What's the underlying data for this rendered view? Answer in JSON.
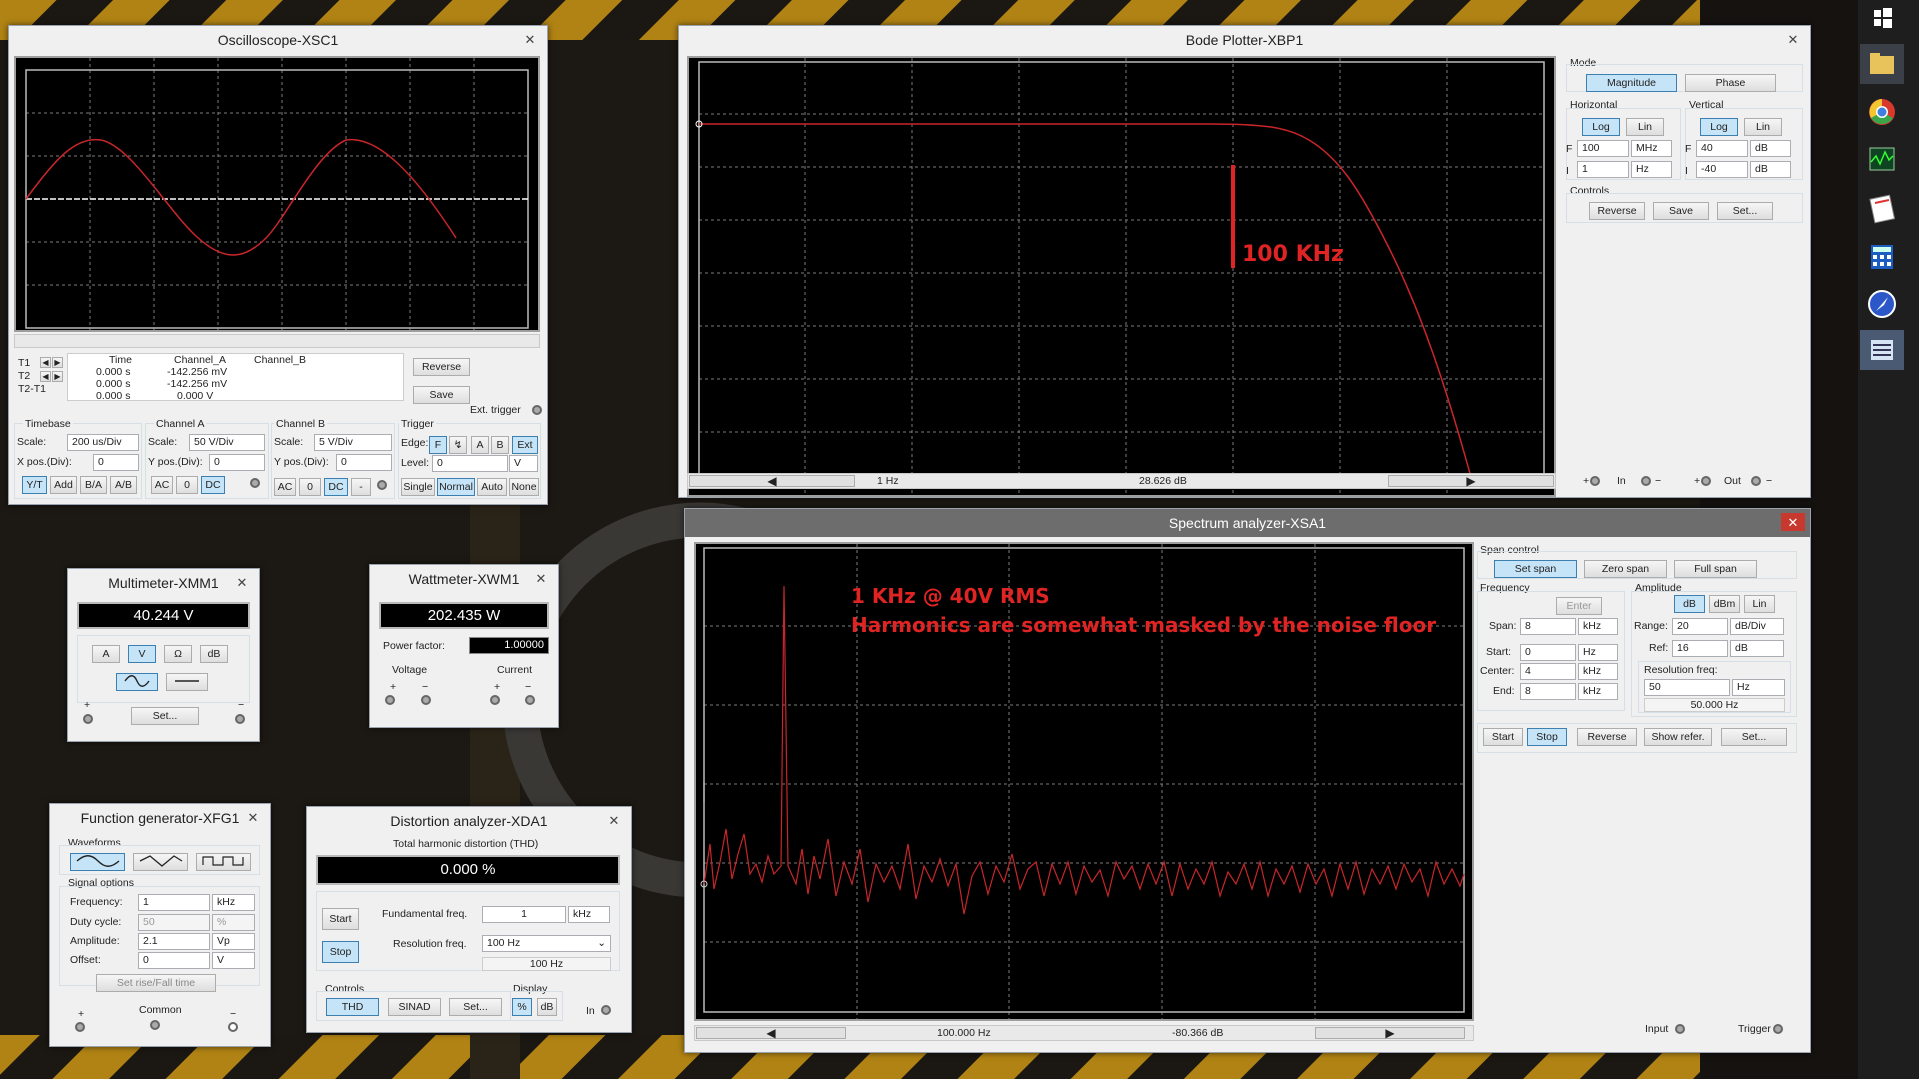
{
  "oscilloscope": {
    "title": "Oscilloscope-XSC1",
    "close": "✕",
    "readout": {
      "col_time": "Time",
      "col_a": "Channel_A",
      "col_b": "Channel_B",
      "rows": [
        {
          "label": "T1",
          "time": "0.000 s",
          "a": "-142.256 mV"
        },
        {
          "label": "T2",
          "time": "0.000 s",
          "a": "-142.256 mV"
        },
        {
          "label": "T2-T1",
          "time": "0.000 s",
          "a": "0.000 V"
        }
      ]
    },
    "reverse": "Reverse",
    "save": "Save",
    "ext_trigger": "Ext. trigger",
    "timebase": {
      "title": "Timebase",
      "scale_label": "Scale:",
      "scale": "200 us/Div",
      "xpos_label": "X pos.(Div):",
      "xpos": "0",
      "buttons": [
        "Y/T",
        "Add",
        "B/A",
        "A/B"
      ]
    },
    "channel_a": {
      "title": "Channel A",
      "scale_label": "Scale:",
      "scale": "50  V/Div",
      "ypos_label": "Y pos.(Div):",
      "ypos": "0",
      "buttons": [
        "AC",
        "0",
        "DC"
      ]
    },
    "channel_b": {
      "title": "Channel B",
      "scale_label": "Scale:",
      "scale": "5  V/Div",
      "ypos_label": "Y pos.(Div):",
      "ypos": "0",
      "buttons": [
        "AC",
        "0",
        "DC",
        "-"
      ]
    },
    "trigger": {
      "title": "Trigger",
      "edge_label": "Edge:",
      "edge_buttons": [
        "F",
        "↯",
        "A",
        "B",
        "Ext"
      ],
      "level_label": "Level:",
      "level": "0",
      "level_unit": "V",
      "mode_buttons": [
        "Single",
        "Normal",
        "Auto",
        "None"
      ]
    }
  },
  "bode": {
    "title": "Bode Plotter-XBP1",
    "close": "✕",
    "annotation": "100 KHz",
    "status": {
      "freq": "1 Hz",
      "value": "28.626 dB"
    },
    "mode": {
      "title": "Mode",
      "magnitude": "Magnitude",
      "phase": "Phase"
    },
    "horizontal": {
      "title": "Horizontal",
      "log": "Log",
      "lin": "Lin",
      "f_label": "F",
      "f_value": "100",
      "f_unit": "MHz",
      "i_label": "I",
      "i_value": "1",
      "i_unit": "Hz"
    },
    "vertical": {
      "title": "Vertical",
      "log": "Log",
      "lin": "Lin",
      "f_label": "F",
      "f_value": "40",
      "f_unit": "dB",
      "i_label": "I",
      "i_value": "-40",
      "i_unit": "dB"
    },
    "controls": {
      "title": "Controls",
      "reverse": "Reverse",
      "save": "Save",
      "set": "Set..."
    },
    "terminals": {
      "in_label": "In",
      "out_label": "Out",
      "plus": "+",
      "minus": "−"
    }
  },
  "multimeter": {
    "title": "Multimeter-XMM1",
    "close": "✕",
    "reading": "40.244 V",
    "modes": [
      "A",
      "V",
      "Ω",
      "dB"
    ],
    "set": "Set...",
    "plus": "+",
    "minus": "−"
  },
  "wattmeter": {
    "title": "Wattmeter-XWM1",
    "close": "✕",
    "reading": "202.435 W",
    "pf_label": "Power factor:",
    "pf_value": "1.00000",
    "voltage": "Voltage",
    "current": "Current",
    "plus": "+",
    "minus": "−"
  },
  "function_generator": {
    "title": "Function generator-XFG1",
    "close": "✕",
    "waveforms_title": "Waveforms",
    "signal_title": "Signal options",
    "fields": [
      {
        "label": "Frequency:",
        "value": "1",
        "unit": "kHz"
      },
      {
        "label": "Duty cycle:",
        "value": "50",
        "unit": "%"
      },
      {
        "label": "Amplitude:",
        "value": "2.1",
        "unit": "Vp"
      },
      {
        "label": "Offset:",
        "value": "0",
        "unit": "V"
      }
    ],
    "rise_fall": "Set rise/Fall time",
    "common": "Common",
    "plus": "+",
    "minus": "−"
  },
  "distortion": {
    "title": "Distortion analyzer-XDA1",
    "close": "✕",
    "thd_title": "Total harmonic distortion (THD)",
    "thd_value": "0.000 %",
    "start": "Start",
    "stop": "Stop",
    "fund_label": "Fundamental freq.",
    "fund_value": "1",
    "fund_unit": "kHz",
    "res_label": "Resolution freq.",
    "res_value": "100 Hz",
    "res_display": "100 Hz",
    "controls_title": "Controls",
    "display_title": "Display",
    "thd": "THD",
    "sinad": "SINAD",
    "set": "Set...",
    "pct": "%",
    "db": "dB",
    "in": "In"
  },
  "spectrum": {
    "title": "Spectrum analyzer-XSA1",
    "close": "✕",
    "annotation1": "1 KHz @ 40V RMS",
    "annotation2": "Harmonics are somewhat masked by the noise floor",
    "status": {
      "freq": "100.000 Hz",
      "value": "-80.366 dB"
    },
    "span_control": {
      "title": "Span control",
      "set_span": "Set span",
      "zero_span": "Zero span",
      "full_span": "Full span"
    },
    "frequency": {
      "title": "Frequency",
      "enter": "Enter",
      "span_label": "Span:",
      "span": "8",
      "span_unit": "kHz",
      "start_label": "Start:",
      "start": "0",
      "start_unit": "Hz",
      "center_label": "Center:",
      "center": "4",
      "center_unit": "kHz",
      "end_label": "End:",
      "end": "8",
      "end_unit": "kHz"
    },
    "amplitude": {
      "title": "Amplitude",
      "db": "dB",
      "dbm": "dBm",
      "lin": "Lin",
      "range_label": "Range:",
      "range": "20",
      "range_unit": "dB/Div",
      "ref_label": "Ref:",
      "ref": "16",
      "ref_unit": "dB"
    },
    "resolution": {
      "title": "Resolution freq:",
      "value": "50",
      "unit": "Hz",
      "display": "50.000  Hz"
    },
    "buttons": {
      "start": "Start",
      "stop": "Stop",
      "reverse": "Reverse",
      "show_refer": "Show refer.",
      "set": "Set..."
    },
    "input": "Input",
    "trigger": "Trigger"
  },
  "colors": {
    "trace": "#c8262a",
    "annotation": "#e02424",
    "active_button": "#c6e4f7"
  },
  "taskbar": {
    "icons": [
      "windows-icon",
      "file-explorer-icon",
      "chrome-icon",
      "performance-monitor-icon",
      "notepad-icon",
      "calculator-icon",
      "internet-icon",
      "multisim-icon"
    ]
  }
}
